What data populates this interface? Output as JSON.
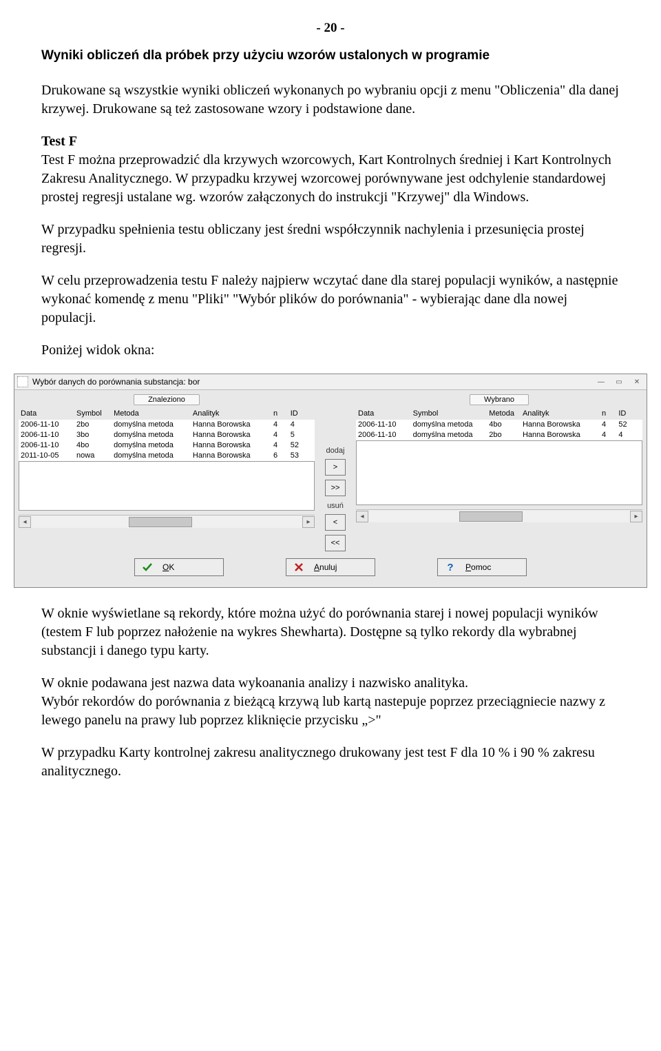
{
  "page_number": "- 20 -",
  "title": "Wyniki obliczeń dla próbek przy użyciu wzorów ustalonych w programie",
  "p1": "Drukowane są wszystkie wyniki obliczeń wykonanych po wybraniu opcji z menu \"Obliczenia\" dla danej krzywej. Drukowane są też zastosowane wzory i podstawione dane.",
  "testf_label": "Test F",
  "p2": "Test F można przeprowadzić dla krzywych wzorcowych, Kart Kontrolnych średniej i Kart Kontrolnych Zakresu Analitycznego. W przypadku  krzywej wzorcowej porównywane jest odchylenie standardowej prostej regresji ustalane wg. wzorów załączonych do instrukcji \"Krzywej\" dla Windows.",
  "p3": "W przypadku spełnienia testu obliczany jest średni współczynnik nachylenia i przesunięcia prostej regresji.",
  "p4": "W celu przeprowadzenia testu F należy najpierw wczytać dane dla starej populacji wyników, a następnie wykonać komendę  z menu \"Pliki\"  \"Wybór plików do porównania\" - wybierając dane dla nowej populacji.",
  "p5": "Poniżej widok okna:",
  "p6": "W oknie wyświetlane są rekordy, które można użyć do porównania starej i nowej populacji wyników  (testem F lub poprzez nałożenie na wykres Shewharta). Dostępne są tylko rekordy dla wybrabnej substancji i danego typu karty.",
  "p7": "W oknie podawana jest nazwa data wykoanania analizy i nazwisko analityka.",
  "p8": "Wybór rekordów do porównania z bieżącą krzywą lub kartą nastepuje poprzez przeciągniecie nazwy z lewego panelu na prawy lub poprzez kliknięcie przycisku „>\"",
  "p9": "W przypadku Karty kontrolnej zakresu analitycznego drukowany jest test F dla 10 % i 90 % zakresu analitycznego.",
  "window": {
    "title": "Wybór danych do porównania    substancja: bor",
    "group_left": "Znaleziono",
    "group_right": "Wybrano",
    "headers": [
      "Data",
      "Symbol",
      "Metoda",
      "Analityk",
      "n",
      "ID"
    ],
    "left_rows": [
      {
        "Data": "2006-11-10",
        "Symbol": "2bo",
        "Metoda": "domyślna metoda",
        "Analityk": "Hanna Borowska",
        "n": "4",
        "ID": "4"
      },
      {
        "Data": "2006-11-10",
        "Symbol": "3bo",
        "Metoda": "domyślna metoda",
        "Analityk": "Hanna Borowska",
        "n": "4",
        "ID": "5"
      },
      {
        "Data": "2006-11-10",
        "Symbol": "4bo",
        "Metoda": "domyślna metoda",
        "Analityk": "Hanna Borowska",
        "n": "4",
        "ID": "52"
      },
      {
        "Data": "2011-10-05",
        "Symbol": "nowa",
        "Metoda": "domyślna metoda",
        "Analityk": "Hanna Borowska",
        "n": "6",
        "ID": "53"
      }
    ],
    "right_rows": [
      {
        "Data": "2006-11-10",
        "Symbol": "domyślna metoda",
        "Metoda": "4bo",
        "Analityk": "Hanna Borowska",
        "n": "4",
        "ID": "52"
      },
      {
        "Data": "2006-11-10",
        "Symbol": "domyślna metoda",
        "Metoda": "2bo",
        "Analityk": "Hanna Borowska",
        "n": "4",
        "ID": "4"
      }
    ],
    "mid": {
      "add_label": "dodaj",
      "add_one": ">",
      "add_all": ">>",
      "remove_label": "usuń",
      "remove_one": "<",
      "remove_all": "<<"
    },
    "buttons": {
      "ok": "OK",
      "cancel": "Anuluj",
      "help": "Pomoc"
    }
  }
}
